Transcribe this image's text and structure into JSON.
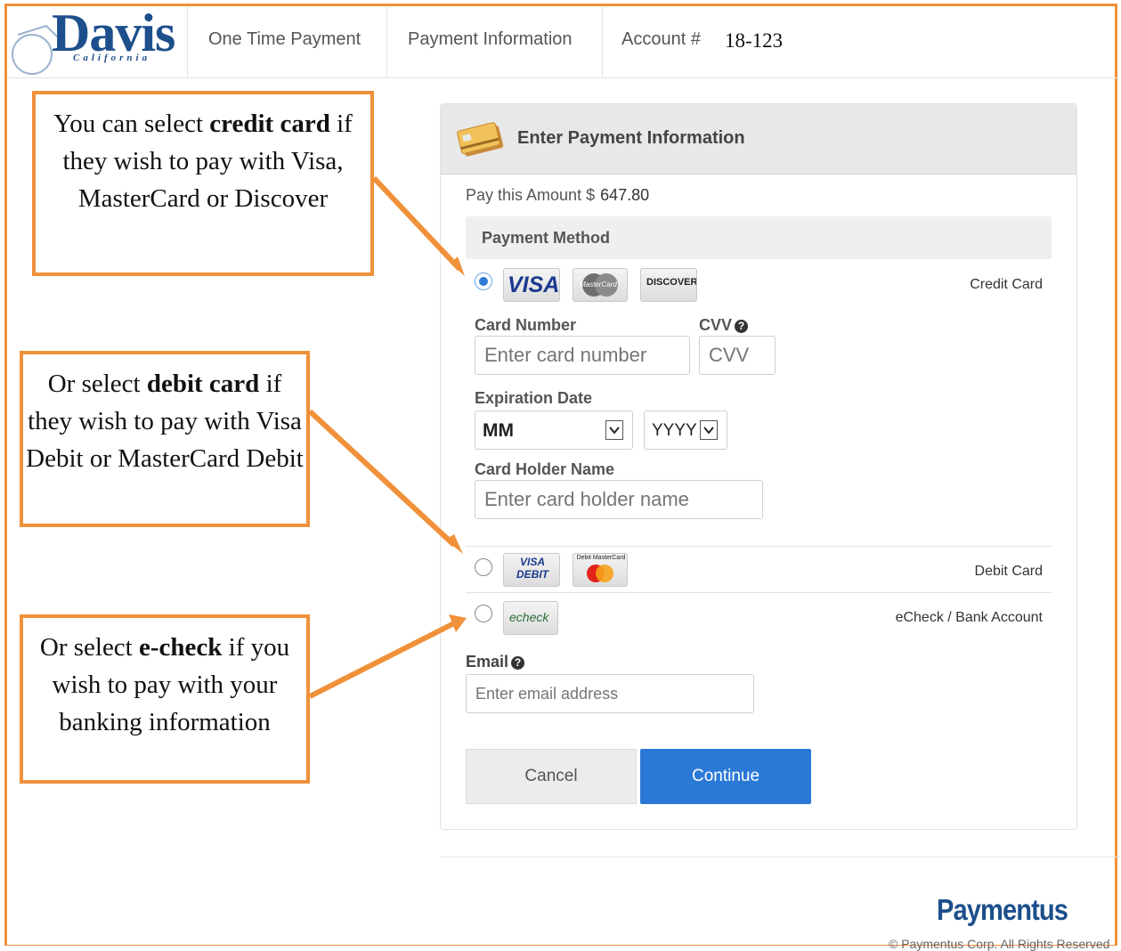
{
  "header": {
    "logo_text": "Davis",
    "logo_sub": "California",
    "nav": [
      "One Time Payment",
      "Payment Information",
      "Account #"
    ],
    "account_number": "18-123"
  },
  "callouts": {
    "credit": {
      "pre": "You can select ",
      "bold": "credit card",
      "post": " if they wish to pay with Visa, MasterCard or Discover"
    },
    "debit": {
      "pre": "Or select ",
      "bold": "debit card",
      "post": " if they wish to pay with Visa Debit or MasterCard Debit"
    },
    "echeck": {
      "pre": "Or select ",
      "bold": "e-check",
      "post": " if you wish to pay with your banking information"
    }
  },
  "panel": {
    "title": "Enter Payment Information",
    "pay_label": "Pay this Amount $",
    "pay_amount": "647.80",
    "payment_method_label": "Payment Method",
    "options": {
      "credit": {
        "label": "Credit Card",
        "selected": true,
        "cards": [
          "VISA",
          "MasterCard",
          "DISCOVER"
        ]
      },
      "debit": {
        "label": "Debit Card",
        "selected": false,
        "cards": [
          "VISA DEBIT",
          "Debit MasterCard"
        ]
      },
      "echeck": {
        "label": "eCheck / Bank Account",
        "selected": false,
        "cards": [
          "echeck"
        ]
      }
    },
    "card_number_label": "Card Number",
    "card_number_placeholder": "Enter card number",
    "cvv_label": "CVV",
    "cvv_placeholder": "CVV",
    "expiration_label": "Expiration Date",
    "month_value": "MM",
    "year_value": "YYYY",
    "holder_label": "Card Holder Name",
    "holder_placeholder": "Enter card holder name",
    "email_label": "Email",
    "email_placeholder": "Enter email address",
    "cancel_label": "Cancel",
    "continue_label": "Continue"
  },
  "footer": {
    "brand": "Paymentus",
    "copyright": "© Paymentus Corp. All Rights Reserved"
  },
  "colors": {
    "accent_orange": "#f0913a",
    "brand_blue": "#1d4f8c",
    "button_blue": "#2a79d6"
  }
}
